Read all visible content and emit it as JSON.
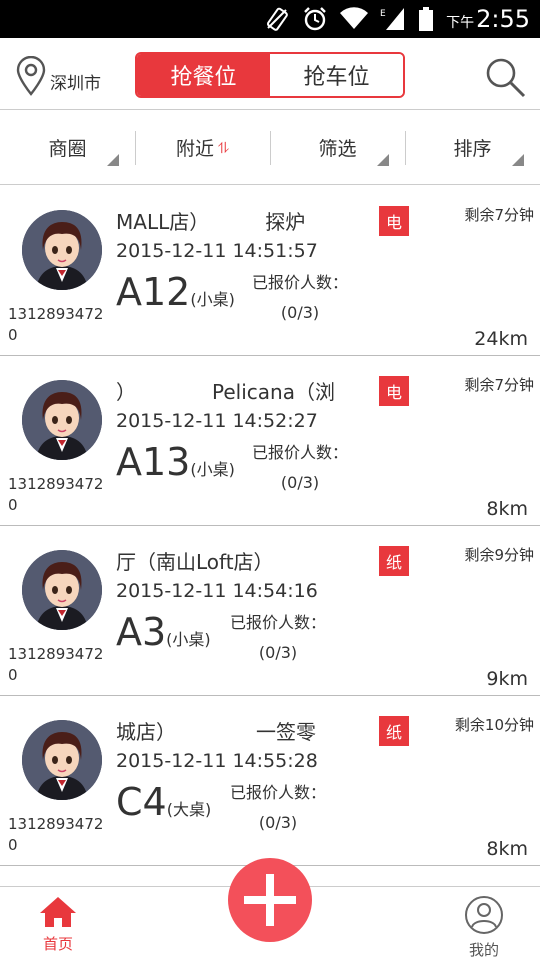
{
  "status_bar": {
    "time_prefix": "下午",
    "time": "2:55",
    "network": "E"
  },
  "header": {
    "city": "深圳市",
    "tabs": [
      {
        "label": "抢餐位",
        "active": true
      },
      {
        "label": "抢车位",
        "active": false
      }
    ]
  },
  "filters": [
    {
      "label": "商圈",
      "icon": "triangle-corner"
    },
    {
      "label": "附近",
      "icon": "sort-updown-icon"
    },
    {
      "label": "筛选",
      "icon": "triangle-corner"
    },
    {
      "label": "排序",
      "icon": "triangle-corner"
    }
  ],
  "items": [
    {
      "shop_text": "MALL店）",
      "shop_text2": "探炉",
      "tag": "电",
      "remaining": "剩余7分钟",
      "time": "2015-12-11 14:51:57",
      "table": "A12",
      "size": "(小桌)",
      "quote_label": "已报价人数：",
      "quote_value": "(0/3)",
      "distance": "24km",
      "phone": "13128934720"
    },
    {
      "shop_text": "）",
      "shop_text2": "Pelicana（浏",
      "tag": "电",
      "remaining": "剩余7分钟",
      "time": "2015-12-11 14:52:27",
      "table": "A13",
      "size": "(小桌)",
      "quote_label": "已报价人数：",
      "quote_value": "(0/3)",
      "distance": "8km",
      "phone": "13128934720"
    },
    {
      "shop_text": "厅（南山Loft店）",
      "shop_text2": "",
      "tag": "纸",
      "remaining": "剩余9分钟",
      "time": "2015-12-11 14:54:16",
      "table": "A3",
      "size": "(小桌)",
      "quote_label": "已报价人数：",
      "quote_value": "(0/3)",
      "distance": "9km",
      "phone": "13128934720"
    },
    {
      "shop_text": "城店）",
      "shop_text2": "一签零",
      "tag": "纸",
      "remaining": "剩余10分钟",
      "time": "2015-12-11 14:55:28",
      "table": "C4",
      "size": "(大桌)",
      "quote_label": "已报价人数：",
      "quote_value": "(0/3)",
      "distance": "8km",
      "phone": "13128934720"
    }
  ],
  "bottom_nav": {
    "home_label": "首页",
    "mine_label": "我的"
  },
  "colors": {
    "accent": "#e8383d",
    "fab": "#f3505a"
  }
}
